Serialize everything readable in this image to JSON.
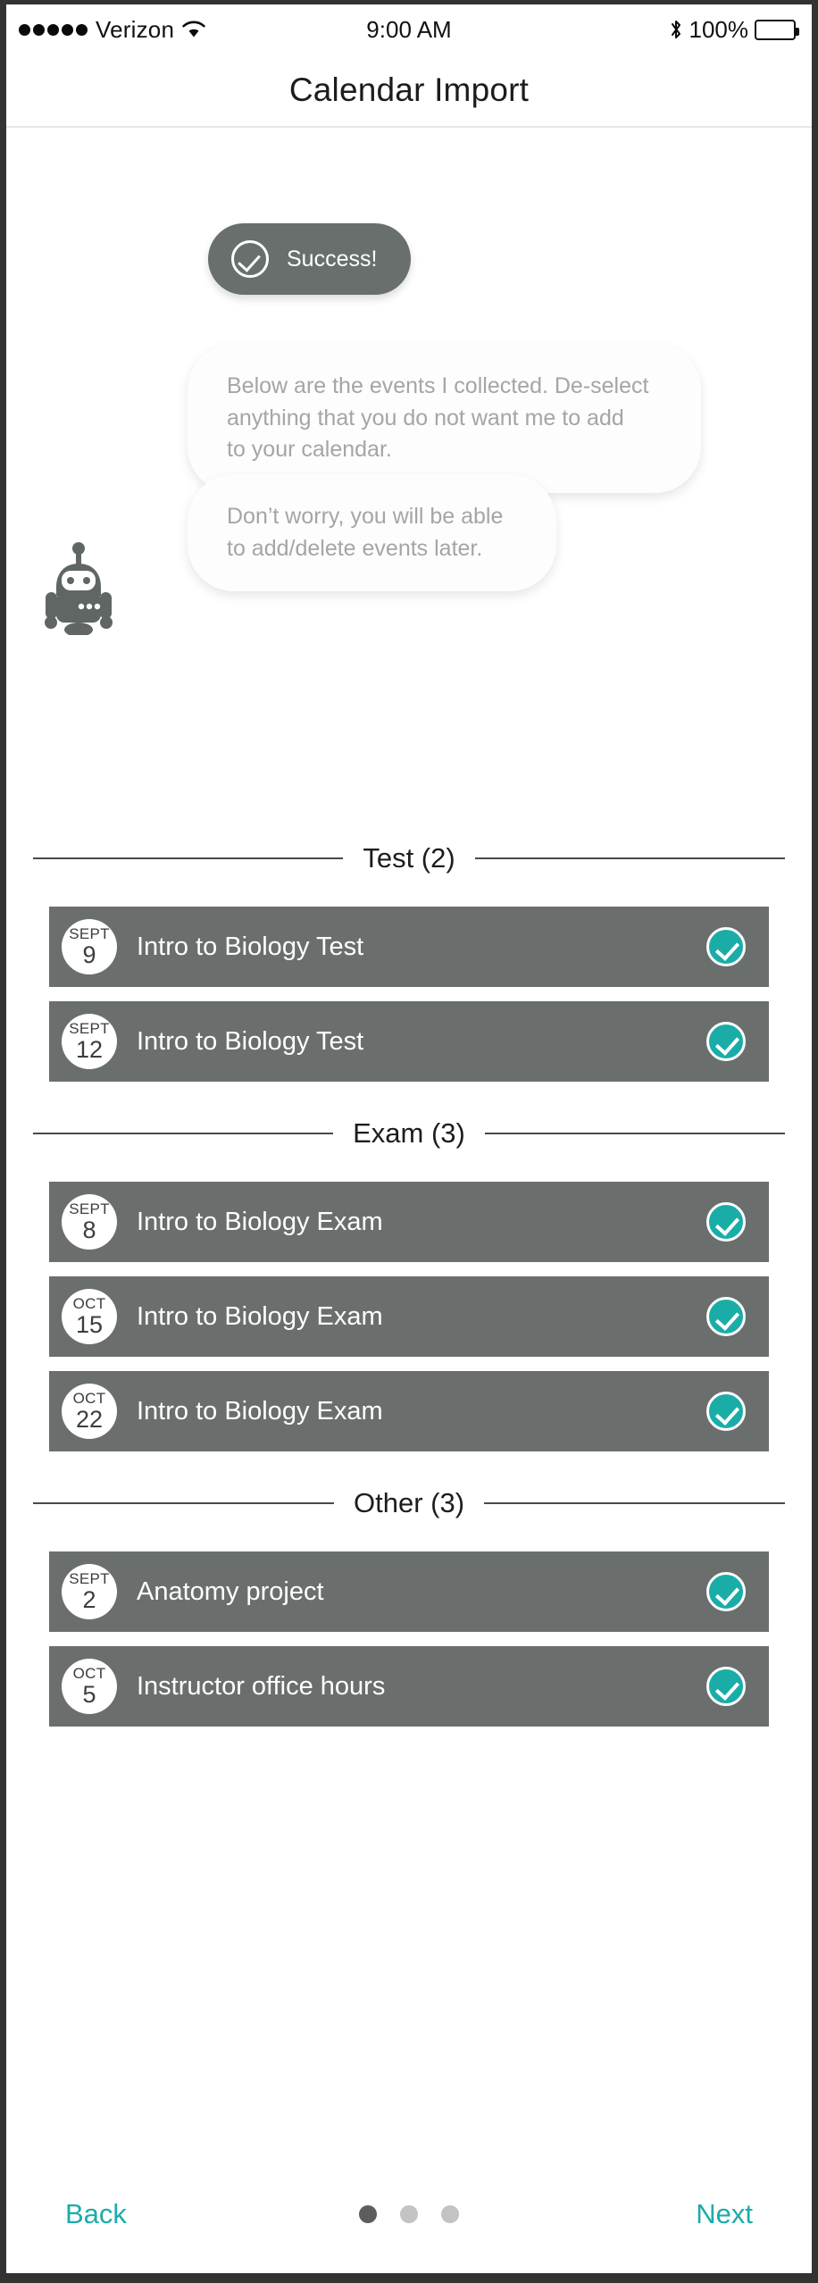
{
  "status_bar": {
    "signal_dots": 5,
    "carrier": "Verizon",
    "wifi_icon": "wifi-icon",
    "time": "9:00 AM",
    "bluetooth_icon": "bluetooth-icon",
    "battery_percent": "100%",
    "battery_icon": "battery-full-icon"
  },
  "header": {
    "title": "Calendar Import"
  },
  "assistant": {
    "avatar_icon": "robot-avatar-icon",
    "success_badge": {
      "icon": "check-circle-icon",
      "label": "Success!"
    },
    "messages": [
      "Below are the events I collected. De-select anything that you do not want me to add\nto your calendar.",
      "Don’t worry, you will be able to add/delete events later."
    ]
  },
  "sections": [
    {
      "label": "Test (2)",
      "events": [
        {
          "month": "SEPT",
          "day": "9",
          "title": "Intro to Biology Test",
          "selected": true
        },
        {
          "month": "SEPT",
          "day": "12",
          "title": "Intro to Biology Test",
          "selected": true
        }
      ]
    },
    {
      "label": "Exam (3)",
      "events": [
        {
          "month": "SEPT",
          "day": "8",
          "title": "Intro to Biology Exam",
          "selected": true
        },
        {
          "month": "OCT",
          "day": "15",
          "title": "Intro to Biology Exam",
          "selected": true
        },
        {
          "month": "OCT",
          "day": "22",
          "title": "Intro to Biology Exam",
          "selected": true
        }
      ]
    },
    {
      "label": "Other (3)",
      "events": [
        {
          "month": "SEPT",
          "day": "2",
          "title": "Anatomy project",
          "selected": true
        },
        {
          "month": "OCT",
          "day": "5",
          "title": "Instructor office hours",
          "selected": true
        }
      ]
    }
  ],
  "footer": {
    "back_label": "Back",
    "next_label": "Next",
    "page_dots": {
      "count": 3,
      "active_index": 0
    }
  },
  "colors": {
    "accent_teal": "#1aada8",
    "row_gray": "#6a6f6d",
    "bubble_gray": "#696f6c",
    "muted_text": "#a5a5a5"
  }
}
